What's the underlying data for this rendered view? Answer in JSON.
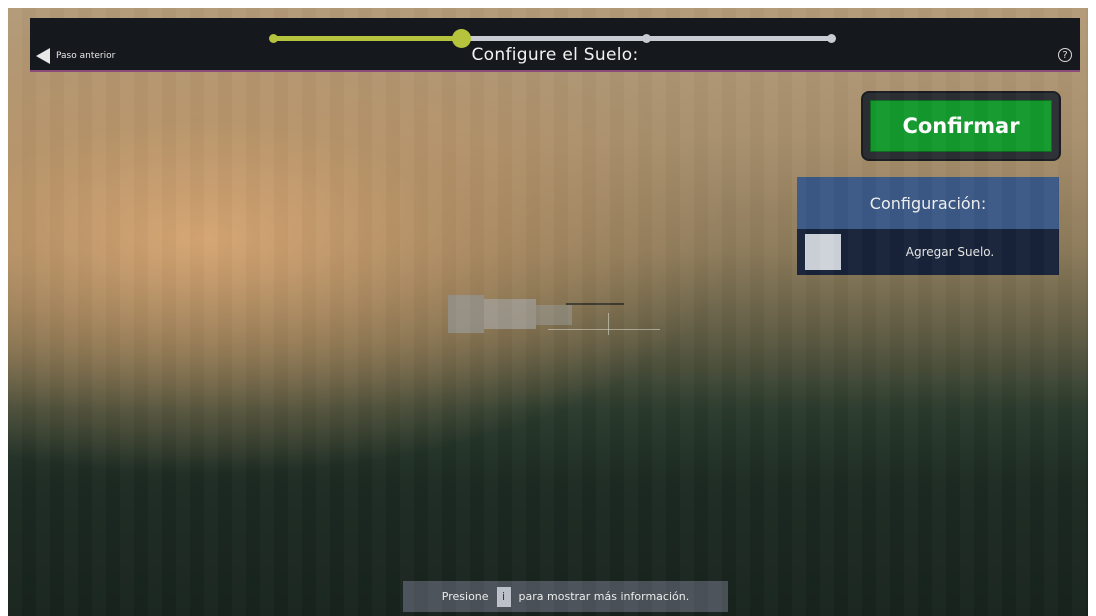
{
  "header": {
    "back_label": "Paso anterior",
    "title": "Configure el Suelo:",
    "help_icon": "question-mark-circle-icon",
    "progress": {
      "steps_total": 4,
      "current_step": 2,
      "active_color": "#b5c43c",
      "inactive_color": "#c8ccd2"
    }
  },
  "confirm": {
    "label": "Confirmar",
    "color": "#139a2e"
  },
  "config_panel": {
    "title": "Configuración:",
    "items": [
      {
        "label": "Agregar Suelo.",
        "checked": false
      }
    ]
  },
  "hint": {
    "prefix": "Presione",
    "key": "i",
    "suffix": "para mostrar más información."
  }
}
